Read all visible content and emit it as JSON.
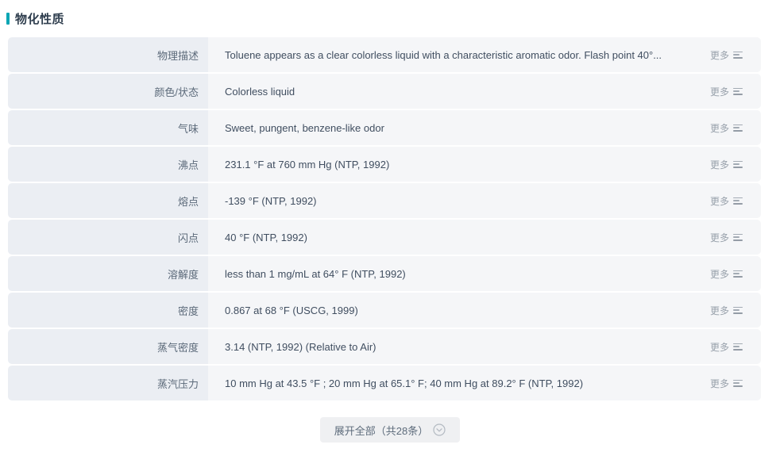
{
  "section": {
    "title": "物化性质",
    "accent_color": "#0ba6b4"
  },
  "table": {
    "more_label": "更多",
    "more_icon": "list-lines-icon",
    "rows": [
      {
        "label": "物理描述",
        "value": "Toluene appears as a clear colorless liquid with a characteristic aromatic odor. Flash point 40°..."
      },
      {
        "label": "颜色/状态",
        "value": "Colorless liquid"
      },
      {
        "label": "气味",
        "value": "Sweet, pungent, benzene-like odor"
      },
      {
        "label": "沸点",
        "value": "231.1 °F at 760 mm Hg (NTP, 1992)"
      },
      {
        "label": "熔点",
        "value": "-139 °F (NTP, 1992)"
      },
      {
        "label": "闪点",
        "value": "40 °F (NTP, 1992)"
      },
      {
        "label": "溶解度",
        "value": "less than 1 mg/mL at 64° F (NTP, 1992)"
      },
      {
        "label": "密度",
        "value": "0.867 at 68 °F (USCG, 1999)"
      },
      {
        "label": "蒸气密度",
        "value": "3.14 (NTP, 1992) (Relative to Air)"
      },
      {
        "label": "蒸汽压力",
        "value": "10 mm Hg at 43.5 °F ; 20 mm Hg at 65.1° F; 40 mm Hg at 89.2° F (NTP, 1992)"
      }
    ]
  },
  "footer": {
    "expand_label": "展开全部（共28条）",
    "expand_icon": "chevron-down-circle-icon",
    "total_count": "28"
  }
}
